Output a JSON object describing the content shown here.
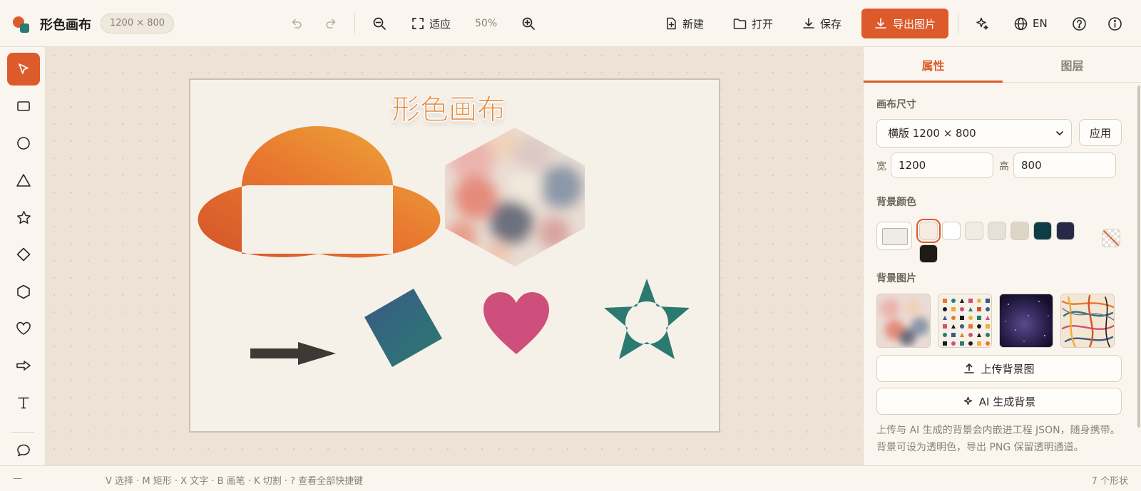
{
  "app": {
    "title": "形色画布",
    "canvas_size": "1200 × 800"
  },
  "toolbar": {
    "fit_label": "适应",
    "zoom": "50%",
    "new_label": "新建",
    "open_label": "打开",
    "save_label": "保存",
    "export_label": "导出图片",
    "language": "EN",
    "icons": [
      "undo-icon",
      "redo-icon",
      "zoom-out-icon",
      "fit-icon",
      "zoom-in-icon",
      "new-file-icon",
      "folder-icon",
      "download-icon",
      "sparkle-icon",
      "globe-icon",
      "help-icon",
      "info-icon"
    ]
  },
  "tools": [
    "select",
    "rectangle",
    "circle",
    "triangle",
    "star",
    "diamond",
    "hexagon",
    "heart",
    "arrow",
    "text",
    "speech-bubble"
  ],
  "canvas": {
    "title_text": "形色画布",
    "colors": {
      "orange": "#e8772f",
      "yellow": "#eeae3c",
      "orange_dark": "#d4542a",
      "teal": "#2a7a70",
      "navy": "#3a5a86",
      "pink": "#cf4f7c",
      "arrow": "#3d3a36",
      "artboard": "#f6f1e8"
    }
  },
  "panel": {
    "tabs": [
      "属性",
      "图层"
    ],
    "active_tab": "属性",
    "canvas_size_label": "画布尺寸",
    "preset_value": "横版 1200 × 800",
    "apply_label": "应用",
    "width_label": "宽",
    "width_value": "1200",
    "height_label": "高",
    "height_value": "800",
    "bg_color_label": "背景颜色",
    "bg_swatches": [
      "#f4ece3",
      "#ffffff",
      "#f0ebe3",
      "#e5e1d8",
      "#dcd6c7",
      "#0f3d46",
      "#262a48",
      "#1d1a17"
    ],
    "selected_swatch": "#f4ece3",
    "bg_image_label": "背景图片",
    "bg_images": [
      "bokeh",
      "geometric-pattern",
      "galaxy",
      "colorful-strokes"
    ],
    "upload_label": "上传背景图",
    "ai_label": "AI 生成背景",
    "hint": "上传与 AI 生成的背景会内嵌进工程 JSON，随身携带。背景可设为透明色，导出 PNG 保留透明通道。"
  },
  "status": {
    "dash": "—",
    "shortcuts": "V 选择 · M 矩形 · X 文字 · B 画笔 · K 切割 · ? 查看全部快捷键",
    "shape_count": "7 个形状"
  }
}
